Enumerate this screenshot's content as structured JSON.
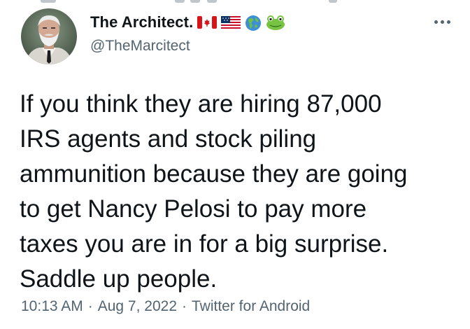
{
  "tweet": {
    "display_name": "The Architect.",
    "handle": "@TheMarcitect",
    "name_emojis": [
      "canada-flag-icon",
      "us-flag-icon",
      "globe-americas-icon",
      "frog-icon"
    ],
    "body_lines": [
      "If you think they are hiring 87,000",
      "IRS agents and stock piling",
      "ammunition because they are going",
      "to get Nancy Pelosi to pay more",
      "taxes you are in for a big surprise.",
      "Saddle up people."
    ],
    "time": "10:13 AM",
    "date": "Aug 7, 2022",
    "separator": "·",
    "source": "Twitter for Android"
  },
  "colors": {
    "text_primary": "#0f1419",
    "text_secondary": "#536471",
    "background": "#ffffff"
  }
}
